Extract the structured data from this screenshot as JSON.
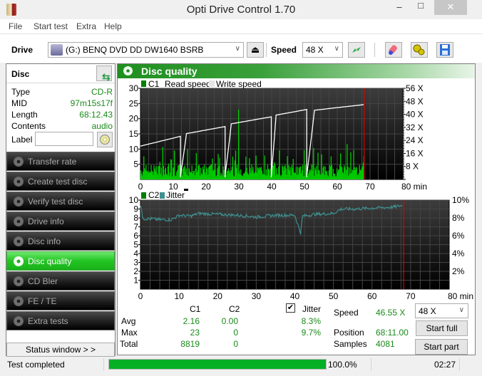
{
  "window": {
    "title": "Opti Drive Control 1.70",
    "min_icon": "minimize-icon",
    "max_icon": "maximize-icon",
    "close_icon": "close-icon",
    "min_glyph": "–",
    "max_glyph": "□",
    "close_glyph": "✕"
  },
  "menu": [
    "File",
    "Start test",
    "Extra",
    "Help"
  ],
  "toolbar": {
    "drive_label": "Drive",
    "drive_value": "(G:)   BENQ DVD DD DW1640 BSRB",
    "speed_label": "Speed",
    "speed_value": "48 X",
    "arrow_glyph": "∨",
    "eject_glyph": "⏏"
  },
  "disc": {
    "header": "Disc",
    "rows": [
      {
        "key": "Type",
        "value": "CD-R"
      },
      {
        "key": "MID",
        "value": "97m15s17f"
      },
      {
        "key": "Length",
        "value": "68:12.43"
      },
      {
        "key": "Contents",
        "value": "audio"
      }
    ],
    "label_key": "Label",
    "label_value": ""
  },
  "nav": [
    {
      "label": "Transfer rate",
      "active": false
    },
    {
      "label": "Create test disc",
      "active": false
    },
    {
      "label": "Verify test disc",
      "active": false
    },
    {
      "label": "Drive info",
      "active": false
    },
    {
      "label": "Disc info",
      "active": false
    },
    {
      "label": "Disc quality",
      "active": true
    },
    {
      "label": "CD Bler",
      "active": false
    },
    {
      "label": "FE / TE",
      "active": false
    },
    {
      "label": "Extra tests",
      "active": false
    }
  ],
  "status_window_label": "Status window > >",
  "panel_title": "Disc quality",
  "colors": {
    "c1": "#00c800",
    "c2": "#008000",
    "jitter": "#3f8f8f",
    "read": "#ffffff",
    "marker": "#e00000",
    "accent": "#1f8f1f"
  },
  "chart_data": [
    {
      "type": "bar",
      "title": "C1 / Read speed",
      "legend": [
        "C1",
        "Read speed",
        "Write speed"
      ],
      "xlabel": "min",
      "x_ticks": [
        "0",
        "10",
        "20",
        "30",
        "40",
        "50",
        "60",
        "70",
        "80 min"
      ],
      "y_ticks_left": [
        "5",
        "10",
        "15",
        "20",
        "25",
        "30"
      ],
      "y_ticks_right": [
        "8 X",
        "16 X",
        "24 X",
        "32 X",
        "40 X",
        "48 X",
        "56 X"
      ],
      "xlim": [
        0,
        80
      ],
      "ylim": [
        0,
        30
      ],
      "y2lim": [
        0,
        56
      ],
      "end_marker_min": 68.2,
      "c1_max": 23,
      "read_speed_segments": [
        {
          "from": 0,
          "to": 12.2,
          "start_x": 20.5,
          "end_x": 26.5
        },
        {
          "from": 12.2,
          "to": 25.8,
          "start_x": 27.5,
          "end_x": 32.5
        },
        {
          "from": 25.8,
          "to": 39.9,
          "start_x": 33.5,
          "end_x": 38.5
        },
        {
          "from": 39.9,
          "to": 50.7,
          "start_x": 39,
          "end_x": 43
        },
        {
          "from": 50.7,
          "to": 68.2,
          "start_x": 42,
          "end_x": 46
        }
      ]
    },
    {
      "type": "line",
      "title": "C2 / Jitter",
      "legend": [
        "C2",
        "Jitter"
      ],
      "xlabel": "min",
      "x_ticks": [
        "0",
        "10",
        "20",
        "30",
        "40",
        "50",
        "60",
        "70",
        "80 min"
      ],
      "y_ticks_left": [
        "1",
        "2",
        "3",
        "4",
        "5",
        "6",
        "7",
        "8",
        "9",
        "10"
      ],
      "y_ticks_right": [
        "2%",
        "4%",
        "6%",
        "8%",
        "10%"
      ],
      "xlim": [
        0,
        80
      ],
      "ylim": [
        0,
        10
      ],
      "y2lim": [
        0,
        10
      ],
      "end_marker_min": 68.2,
      "jitter_points": [
        [
          0,
          9.5
        ],
        [
          0.5,
          8.2
        ],
        [
          1,
          7.9
        ],
        [
          3,
          7.9
        ],
        [
          5,
          7.8
        ],
        [
          8,
          7.8
        ],
        [
          10,
          8.3
        ],
        [
          13,
          8.2
        ],
        [
          15,
          8.5
        ],
        [
          20,
          8.4
        ],
        [
          25,
          8.3
        ],
        [
          28,
          8.2
        ],
        [
          30,
          8.1
        ],
        [
          35,
          8.3
        ],
        [
          40,
          8.3
        ],
        [
          41.5,
          6.3
        ],
        [
          42,
          8.2
        ],
        [
          45,
          8.4
        ],
        [
          50,
          8.5
        ],
        [
          52,
          9.0
        ],
        [
          55,
          9.0
        ],
        [
          60,
          9.1
        ],
        [
          65,
          9.2
        ],
        [
          68,
          9.4
        ]
      ],
      "c2_values": "all 0"
    }
  ],
  "stats": {
    "col_c1": "C1",
    "col_c2": "C2",
    "rows": [
      {
        "label": "Avg",
        "c1": "2.16",
        "c2": "0.00",
        "jitter": "8.3%"
      },
      {
        "label": "Max",
        "c1": "23",
        "c2": "0",
        "jitter": "9.7%"
      },
      {
        "label": "Total",
        "c1": "8819",
        "c2": "0"
      }
    ],
    "jitter_label": "Jitter",
    "jitter_checked": true,
    "speed_label": "Speed",
    "speed_value": "46.55 X",
    "position_label": "Position",
    "position_value": "68:11.00",
    "samples_label": "Samples",
    "samples_value": "4081",
    "speed_select": "48 X",
    "start_full": "Start full",
    "start_part": "Start part"
  },
  "statusbar": {
    "text": "Test completed",
    "progress": 100.0,
    "progress_label": "100.0%",
    "time": "02:27"
  }
}
